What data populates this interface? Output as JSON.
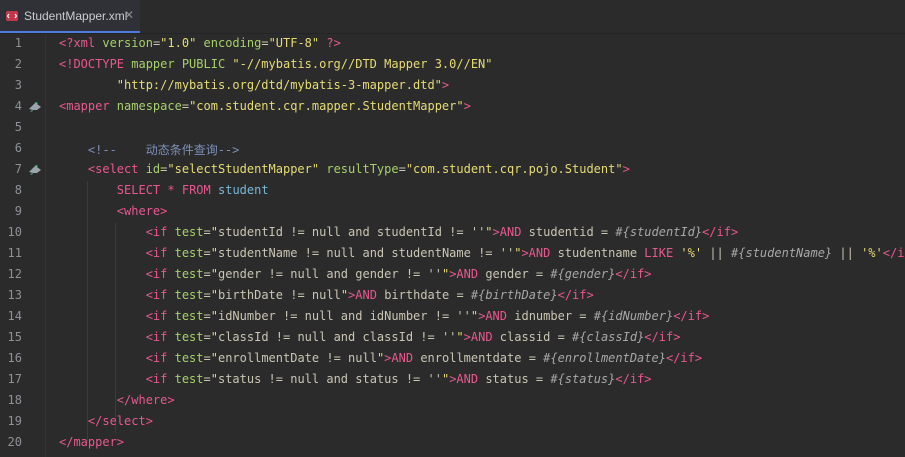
{
  "tab": {
    "title": "StudentMapper.xml",
    "close": "✕"
  },
  "lines": [
    {
      "n": "1",
      "tokens": [
        {
          "c": "t-tag",
          "t": "<?xml "
        },
        {
          "c": "t-attr",
          "t": "version"
        },
        {
          "c": "t-pl",
          "t": "="
        },
        {
          "c": "t-str",
          "t": "\"1.0\""
        },
        {
          "c": "t-pl",
          "t": " "
        },
        {
          "c": "t-attr",
          "t": "encoding"
        },
        {
          "c": "t-pl",
          "t": "="
        },
        {
          "c": "t-str",
          "t": "\"UTF-8\""
        },
        {
          "c": "t-pl",
          "t": " "
        },
        {
          "c": "t-tag",
          "t": "?>"
        }
      ]
    },
    {
      "n": "2",
      "tokens": [
        {
          "c": "t-tag",
          "t": "<!DOCTYPE "
        },
        {
          "c": "t-attr",
          "t": "mapper PUBLIC "
        },
        {
          "c": "t-str",
          "t": "\"-//mybatis.org//DTD Mapper 3.0//EN\""
        }
      ]
    },
    {
      "n": "3",
      "tokens": [
        {
          "c": "t-pl",
          "t": "        "
        },
        {
          "c": "t-str",
          "t": "\"http://mybatis.org/dtd/mybatis-3-mapper.dtd\""
        },
        {
          "c": "t-tag",
          "t": ">"
        }
      ]
    },
    {
      "n": "4",
      "bean": true,
      "tokens": [
        {
          "c": "t-tag",
          "t": "<mapper "
        },
        {
          "c": "t-attr",
          "t": "namespace"
        },
        {
          "c": "t-pl",
          "t": "="
        },
        {
          "c": "t-str",
          "t": "\"com.student.cqr.mapper.StudentMapper\""
        },
        {
          "c": "t-tag",
          "t": ">"
        }
      ]
    },
    {
      "n": "5",
      "tokens": []
    },
    {
      "n": "6",
      "tokens": [
        {
          "c": "t-pl",
          "t": "    "
        },
        {
          "c": "t-com",
          "t": "<!--    动态条件查询-->"
        }
      ]
    },
    {
      "n": "7",
      "bean": true,
      "tokens": [
        {
          "c": "t-pl",
          "t": "    "
        },
        {
          "c": "t-tag",
          "t": "<select "
        },
        {
          "c": "t-attr",
          "t": "id"
        },
        {
          "c": "t-pl",
          "t": "="
        },
        {
          "c": "t-str",
          "t": "\"selectStudentMapper\""
        },
        {
          "c": "t-pl",
          "t": " "
        },
        {
          "c": "t-attr",
          "t": "resultType"
        },
        {
          "c": "t-pl",
          "t": "="
        },
        {
          "c": "t-str",
          "t": "\"com.student.cqr.pojo.Student\""
        },
        {
          "c": "t-tag",
          "t": ">"
        }
      ]
    },
    {
      "n": "8",
      "tokens": [
        {
          "c": "t-pl",
          "t": "        "
        },
        {
          "c": "t-kw",
          "t": "SELECT"
        },
        {
          "c": "t-pl",
          "t": " "
        },
        {
          "c": "t-kw",
          "t": "*"
        },
        {
          "c": "t-pl",
          "t": " "
        },
        {
          "c": "t-kw",
          "t": "FROM"
        },
        {
          "c": "t-pl",
          "t": " "
        },
        {
          "c": "t-id",
          "t": "student"
        }
      ]
    },
    {
      "n": "9",
      "tokens": [
        {
          "c": "t-pl",
          "t": "        "
        },
        {
          "c": "t-tag",
          "t": "<where>"
        }
      ]
    },
    {
      "n": "10",
      "tokens": [
        {
          "c": "t-pl",
          "t": "            "
        },
        {
          "c": "t-tag",
          "t": "<if "
        },
        {
          "c": "t-attr",
          "t": "test"
        },
        {
          "c": "t-pl",
          "t": "="
        },
        {
          "c": "t-str",
          "t": "\""
        },
        {
          "c": "t-pl",
          "t": "studentId != null and studentId != ''"
        },
        {
          "c": "t-str",
          "t": "\""
        },
        {
          "c": "t-tag",
          "t": ">"
        },
        {
          "c": "t-kw",
          "t": "AND"
        },
        {
          "c": "t-pl",
          "t": " studentid = "
        },
        {
          "c": "t-var",
          "t": "#{studentId}"
        },
        {
          "c": "t-tag",
          "t": "</if>"
        }
      ]
    },
    {
      "n": "11",
      "tokens": [
        {
          "c": "t-pl",
          "t": "            "
        },
        {
          "c": "t-tag",
          "t": "<if "
        },
        {
          "c": "t-attr",
          "t": "test"
        },
        {
          "c": "t-pl",
          "t": "="
        },
        {
          "c": "t-str",
          "t": "\""
        },
        {
          "c": "t-pl",
          "t": "studentName != null and studentName != ''"
        },
        {
          "c": "t-str",
          "t": "\""
        },
        {
          "c": "t-tag",
          "t": ">"
        },
        {
          "c": "t-kw",
          "t": "AND"
        },
        {
          "c": "t-pl",
          "t": " studentname "
        },
        {
          "c": "t-kw",
          "t": "LIKE"
        },
        {
          "c": "t-pl",
          "t": " "
        },
        {
          "c": "t-str",
          "t": "'%'"
        },
        {
          "c": "t-pl",
          "t": " || "
        },
        {
          "c": "t-var",
          "t": "#{studentName}"
        },
        {
          "c": "t-pl",
          "t": " || "
        },
        {
          "c": "t-str",
          "t": "'%'"
        },
        {
          "c": "t-tag",
          "t": "</if>"
        }
      ]
    },
    {
      "n": "12",
      "tokens": [
        {
          "c": "t-pl",
          "t": "            "
        },
        {
          "c": "t-tag",
          "t": "<if "
        },
        {
          "c": "t-attr",
          "t": "test"
        },
        {
          "c": "t-pl",
          "t": "="
        },
        {
          "c": "t-str",
          "t": "\""
        },
        {
          "c": "t-pl",
          "t": "gender != null and gender != ''"
        },
        {
          "c": "t-str",
          "t": "\""
        },
        {
          "c": "t-tag",
          "t": ">"
        },
        {
          "c": "t-kw",
          "t": "AND"
        },
        {
          "c": "t-pl",
          "t": " gender = "
        },
        {
          "c": "t-var",
          "t": "#{gender}"
        },
        {
          "c": "t-tag",
          "t": "</if>"
        }
      ]
    },
    {
      "n": "13",
      "tokens": [
        {
          "c": "t-pl",
          "t": "            "
        },
        {
          "c": "t-tag",
          "t": "<if "
        },
        {
          "c": "t-attr",
          "t": "test"
        },
        {
          "c": "t-pl",
          "t": "="
        },
        {
          "c": "t-str",
          "t": "\""
        },
        {
          "c": "t-pl",
          "t": "birthDate != null"
        },
        {
          "c": "t-str",
          "t": "\""
        },
        {
          "c": "t-tag",
          "t": ">"
        },
        {
          "c": "t-kw",
          "t": "AND"
        },
        {
          "c": "t-pl",
          "t": " birthdate = "
        },
        {
          "c": "t-var",
          "t": "#{birthDate}"
        },
        {
          "c": "t-tag",
          "t": "</if>"
        }
      ]
    },
    {
      "n": "14",
      "tokens": [
        {
          "c": "t-pl",
          "t": "            "
        },
        {
          "c": "t-tag",
          "t": "<if "
        },
        {
          "c": "t-attr",
          "t": "test"
        },
        {
          "c": "t-pl",
          "t": "="
        },
        {
          "c": "t-str",
          "t": "\""
        },
        {
          "c": "t-pl",
          "t": "idNumber != null and idNumber != ''"
        },
        {
          "c": "t-str",
          "t": "\""
        },
        {
          "c": "t-tag",
          "t": ">"
        },
        {
          "c": "t-kw",
          "t": "AND"
        },
        {
          "c": "t-pl",
          "t": " idnumber = "
        },
        {
          "c": "t-var",
          "t": "#{idNumber}"
        },
        {
          "c": "t-tag",
          "t": "</if>"
        }
      ]
    },
    {
      "n": "15",
      "tokens": [
        {
          "c": "t-pl",
          "t": "            "
        },
        {
          "c": "t-tag",
          "t": "<if "
        },
        {
          "c": "t-attr",
          "t": "test"
        },
        {
          "c": "t-pl",
          "t": "="
        },
        {
          "c": "t-str",
          "t": "\""
        },
        {
          "c": "t-pl",
          "t": "classId != null and classId != ''"
        },
        {
          "c": "t-str",
          "t": "\""
        },
        {
          "c": "t-tag",
          "t": ">"
        },
        {
          "c": "t-kw",
          "t": "AND"
        },
        {
          "c": "t-pl",
          "t": " classid = "
        },
        {
          "c": "t-var",
          "t": "#{classId}"
        },
        {
          "c": "t-tag",
          "t": "</if>"
        }
      ]
    },
    {
      "n": "16",
      "tokens": [
        {
          "c": "t-pl",
          "t": "            "
        },
        {
          "c": "t-tag",
          "t": "<if "
        },
        {
          "c": "t-attr",
          "t": "test"
        },
        {
          "c": "t-pl",
          "t": "="
        },
        {
          "c": "t-str",
          "t": "\""
        },
        {
          "c": "t-pl",
          "t": "enrollmentDate != null"
        },
        {
          "c": "t-str",
          "t": "\""
        },
        {
          "c": "t-tag",
          "t": ">"
        },
        {
          "c": "t-kw",
          "t": "AND"
        },
        {
          "c": "t-pl",
          "t": " enrollmentdate = "
        },
        {
          "c": "t-var",
          "t": "#{enrollmentDate}"
        },
        {
          "c": "t-tag",
          "t": "</if>"
        }
      ]
    },
    {
      "n": "17",
      "tokens": [
        {
          "c": "t-pl",
          "t": "            "
        },
        {
          "c": "t-tag",
          "t": "<if "
        },
        {
          "c": "t-attr",
          "t": "test"
        },
        {
          "c": "t-pl",
          "t": "="
        },
        {
          "c": "t-str",
          "t": "\""
        },
        {
          "c": "t-pl",
          "t": "status != null and status != ''"
        },
        {
          "c": "t-str",
          "t": "\""
        },
        {
          "c": "t-tag",
          "t": ">"
        },
        {
          "c": "t-kw",
          "t": "AND"
        },
        {
          "c": "t-pl",
          "t": " status = "
        },
        {
          "c": "t-var",
          "t": "#{status}"
        },
        {
          "c": "t-tag",
          "t": "</if>"
        }
      ]
    },
    {
      "n": "18",
      "tokens": [
        {
          "c": "t-pl",
          "t": "        "
        },
        {
          "c": "t-tag",
          "t": "</where>"
        }
      ]
    },
    {
      "n": "19",
      "tokens": [
        {
          "c": "t-pl",
          "t": "    "
        },
        {
          "c": "t-tag",
          "t": "</select>"
        }
      ]
    },
    {
      "n": "20",
      "tokens": [
        {
          "c": "t-tag",
          "t": "</mapper>"
        }
      ]
    }
  ],
  "colors": {
    "background": "#2b2b2b",
    "tag": "#e8588f",
    "attr": "#a6d06a",
    "string": "#e6db74",
    "comment": "#7d8fb8",
    "tab_underline": "#4d7cdc"
  },
  "icons": {
    "tab": "xml-file-icon",
    "gutter": "mybatis-bean-icon"
  }
}
